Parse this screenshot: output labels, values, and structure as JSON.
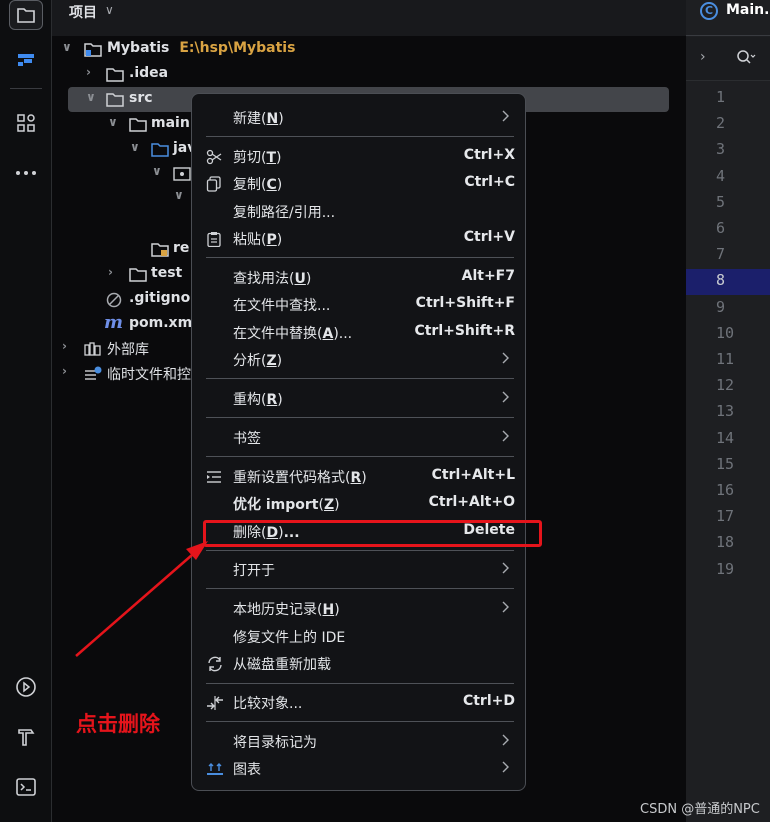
{
  "left_strip": {
    "icons": [
      "project-folder-icon",
      "structure-icon",
      "plugins-icon",
      "more-icon",
      "run-services-icon",
      "build-hammer-icon",
      "terminal-icon"
    ]
  },
  "project_panel": {
    "title": "项目",
    "tree": [
      {
        "name": "Mybatis",
        "path": "E:\\hsp\\Mybatis",
        "level": 0,
        "expanded": true,
        "icon": "module-folder-icon"
      },
      {
        "name": ".idea",
        "level": 1,
        "expanded": false,
        "icon": "folder-icon"
      },
      {
        "name": "src",
        "level": 1,
        "expanded": true,
        "icon": "folder-icon",
        "selected": true
      },
      {
        "name": "main",
        "level": 2,
        "expanded": true,
        "icon": "folder-icon"
      },
      {
        "name": "jav",
        "level": 3,
        "expanded": true,
        "icon": "source-folder-icon"
      },
      {
        "name": "",
        "level": 4,
        "expanded": true,
        "icon": "package-icon"
      },
      {
        "name": "",
        "level": 5,
        "expanded": true,
        "icon": ""
      },
      {
        "name": "re",
        "level": 3,
        "expanded": null,
        "icon": "resources-folder-icon"
      },
      {
        "name": "test",
        "level": 2,
        "expanded": false,
        "icon": "folder-icon"
      },
      {
        "name": ".gitigno",
        "level": 1,
        "expanded": null,
        "icon": "gitignore-icon"
      },
      {
        "name": "pom.xm",
        "level": 1,
        "expanded": null,
        "icon": "maven-icon"
      },
      {
        "name": "外部库",
        "level": 0,
        "expanded": false,
        "icon": "library-icon"
      },
      {
        "name": "临时文件和控",
        "level": 0,
        "expanded": false,
        "icon": "scratches-icon"
      }
    ]
  },
  "editor": {
    "tab": {
      "label": "Main.",
      "icon_letter": "C"
    },
    "line_numbers": [
      "1",
      "2",
      "3",
      "4",
      "5",
      "6",
      "7",
      "8",
      "9",
      "10",
      "11",
      "12",
      "13",
      "14",
      "15",
      "16",
      "17",
      "18",
      "19"
    ],
    "current_line": "8"
  },
  "context_menu": {
    "items": [
      {
        "id": "new",
        "label": "新建",
        "mnemonic": "N",
        "submenu": true
      },
      {
        "separator": true
      },
      {
        "id": "cut",
        "label": "剪切",
        "mnemonic": "T",
        "shortcut": "Ctrl+X",
        "icon": "scissors-icon"
      },
      {
        "id": "copy",
        "label": "复制",
        "mnemonic": "C",
        "shortcut": "Ctrl+C",
        "icon": "copy-icon"
      },
      {
        "id": "copy-path",
        "label": "复制路径/引用..."
      },
      {
        "id": "paste",
        "label": "粘贴",
        "mnemonic": "P",
        "shortcut": "Ctrl+V",
        "icon": "paste-icon"
      },
      {
        "separator": true
      },
      {
        "id": "find-usages",
        "label": "查找用法",
        "mnemonic": "U",
        "shortcut": "Alt+F7"
      },
      {
        "id": "find-in-files",
        "label": "在文件中查找...",
        "shortcut": "Ctrl+Shift+F"
      },
      {
        "id": "replace-in-files",
        "label": "在文件中替换",
        "mnemonic": "A",
        "suffix": "...",
        "shortcut": "Ctrl+Shift+R"
      },
      {
        "id": "analyze",
        "label": "分析",
        "mnemonic": "Z",
        "submenu": true
      },
      {
        "separator": true
      },
      {
        "id": "refactor",
        "label": "重构",
        "mnemonic": "R",
        "submenu": true
      },
      {
        "separator": true
      },
      {
        "id": "bookmarks",
        "label": "书签",
        "submenu": true
      },
      {
        "separator": true
      },
      {
        "id": "reformat",
        "label": "重新设置代码格式",
        "mnemonic": "R",
        "shortcut": "Ctrl+Alt+L",
        "icon": "reformat-icon"
      },
      {
        "id": "optimize-imports",
        "label": "优化 import",
        "mnemonic": "Z",
        "shortcut": "Ctrl+Alt+O"
      },
      {
        "id": "delete",
        "label": "删除",
        "mnemonic": "D",
        "suffix": "...",
        "shortcut": "Delete",
        "highlighted": true
      },
      {
        "separator": true
      },
      {
        "id": "open-in",
        "label": "打开于",
        "submenu": true
      },
      {
        "separator": true
      },
      {
        "id": "local-history",
        "label": "本地历史记录",
        "mnemonic": "H",
        "submenu": true
      },
      {
        "id": "repair-ide",
        "label": "修复文件上的 IDE"
      },
      {
        "id": "reload-from-disk",
        "label": "从磁盘重新加载",
        "icon": "reload-icon"
      },
      {
        "separator": true
      },
      {
        "id": "compare-with",
        "label": "比较对象...",
        "shortcut": "Ctrl+D",
        "icon": "compare-icon"
      },
      {
        "separator": true
      },
      {
        "id": "mark-directory",
        "label": "将目录标记为",
        "submenu": true
      },
      {
        "id": "diagrams",
        "label": "图表",
        "submenu": true,
        "icon": "diagram-icon"
      }
    ]
  },
  "annotation": {
    "text": "点击删除",
    "color": "#e5141b"
  },
  "watermark": "CSDN @普通的NPC",
  "colors": {
    "accent_blue": "#4a8ee0",
    "path_orange": "#d9a343",
    "highlight_red": "#e5141b",
    "current_line_bg": "#1b1f6b"
  }
}
